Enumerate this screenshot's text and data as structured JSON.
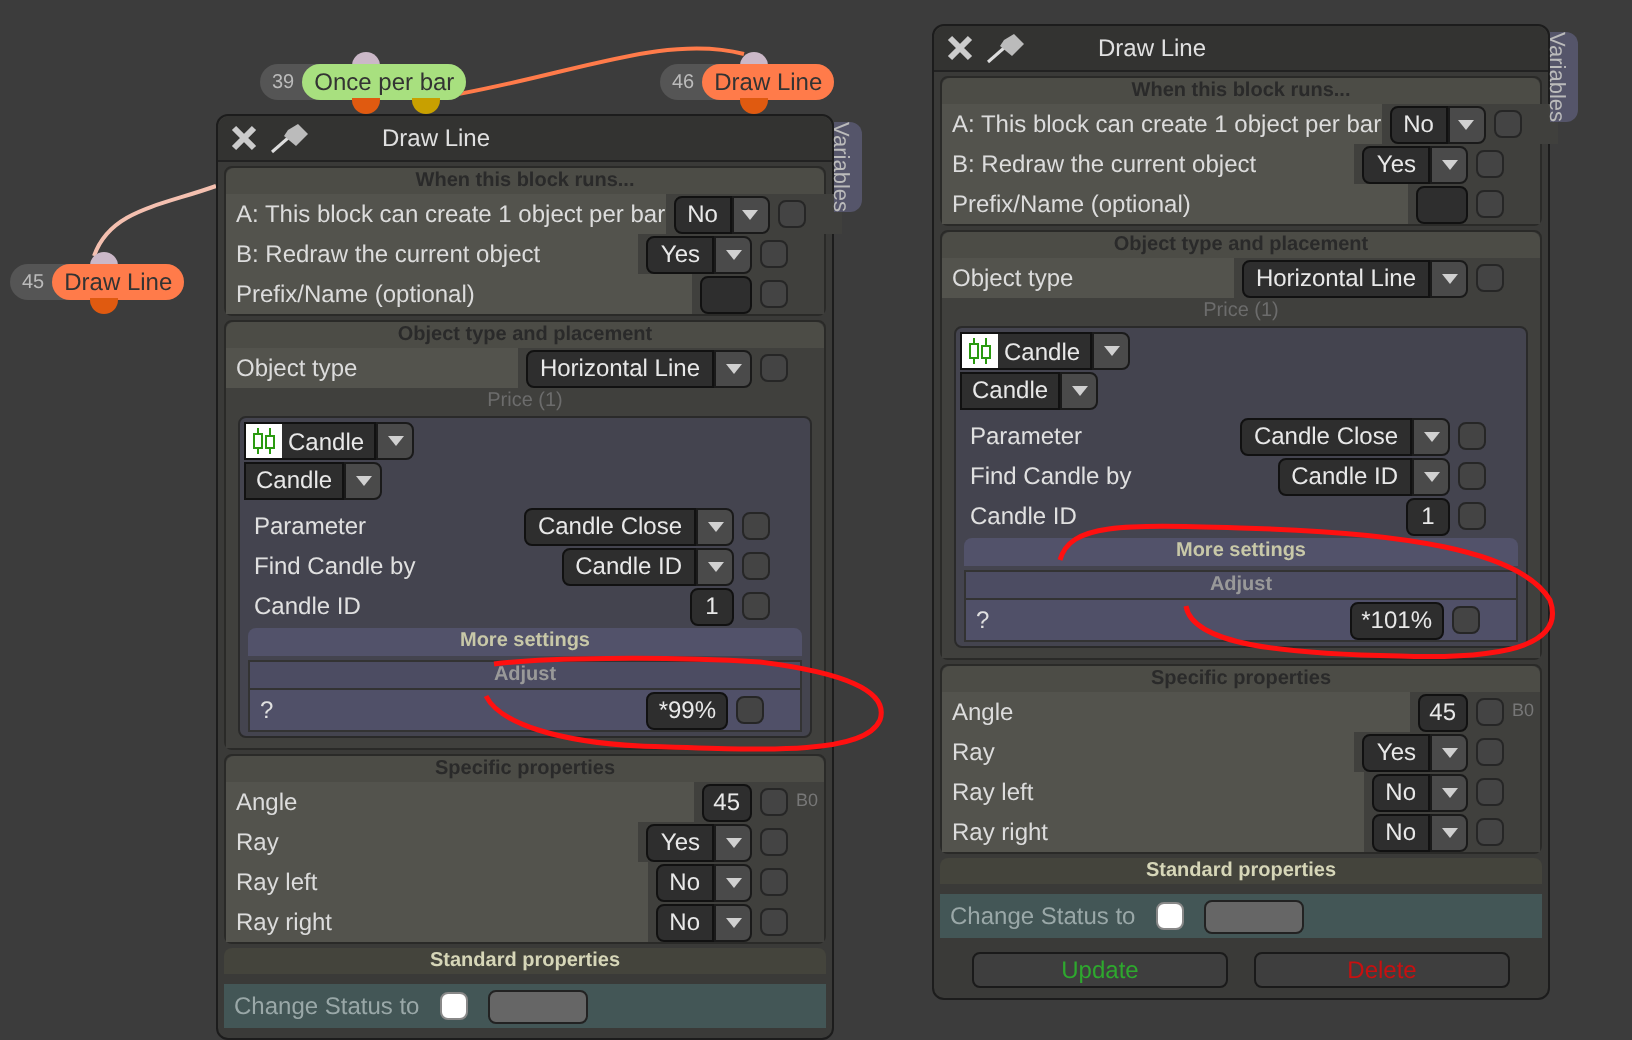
{
  "canvas_nodes": [
    {
      "number": "39",
      "label": "Once per bar",
      "color": "#a8e07f"
    },
    {
      "number": "46",
      "label": "Draw Line",
      "color": "#ff7b4a"
    },
    {
      "number": "45",
      "label": "Draw Line",
      "color": "#ff7b4a"
    }
  ],
  "panels": [
    {
      "title": "Draw Line",
      "side_tab": "Variables",
      "sections": [
        {
          "kind": "rows",
          "heading": "When this block runs...",
          "rows": [
            {
              "kind": "dropdown",
              "label": "A: This block can create 1 object per bar",
              "value": "No",
              "checked": false
            },
            {
              "kind": "dropdown",
              "label": "B: Redraw the current object",
              "value": "Yes",
              "checked": false
            },
            {
              "kind": "input",
              "label": "Prefix/Name (optional)",
              "checked": false
            }
          ]
        },
        {
          "kind": "rows",
          "heading": "Object type and placement",
          "rows": [
            {
              "kind": "dropdown",
              "label": "Object type",
              "value": "Horizontal Line",
              "checked": false
            }
          ],
          "group": {
            "caption": "Price (1)",
            "source": "Candle",
            "mode": "Candle",
            "rows": [
              {
                "kind": "dropdown",
                "label": "Parameter",
                "value": "Candle Close",
                "checked": false
              },
              {
                "kind": "dropdown",
                "label": "Find Candle by",
                "value": "Candle ID",
                "checked": false
              },
              {
                "kind": "input",
                "label": "Candle ID",
                "value": "1",
                "checked": false
              }
            ],
            "more": "More settings",
            "sub_heading": "Adjust",
            "sub_rows": [
              {
                "kind": "input",
                "label": "?",
                "value": "*99%",
                "checked": false
              }
            ]
          }
        },
        {
          "kind": "rows",
          "heading": "Specific properties",
          "rows": [
            {
              "kind": "input",
              "label": "Angle",
              "value": "45",
              "checked": false,
              "note": "B0"
            },
            {
              "kind": "dropdown",
              "label": "Ray",
              "value": "Yes",
              "checked": false
            },
            {
              "kind": "dropdown",
              "label": "Ray left",
              "value": "No",
              "checked": false
            },
            {
              "kind": "dropdown",
              "label": "Ray right",
              "value": "No",
              "checked": false
            }
          ]
        },
        {
          "kind": "status",
          "heading": "Standard properties",
          "label": "Change Status to",
          "checked": false
        }
      ]
    },
    {
      "title": "Draw Line",
      "side_tab": "Variables",
      "sections": [
        {
          "kind": "rows",
          "heading": "When this block runs...",
          "rows": [
            {
              "kind": "dropdown",
              "label": "A: This block can create 1 object per bar",
              "value": "No",
              "checked": false
            },
            {
              "kind": "dropdown",
              "label": "B: Redraw the current object",
              "value": "Yes",
              "checked": false
            },
            {
              "kind": "input",
              "label": "Prefix/Name (optional)",
              "checked": false
            }
          ]
        },
        {
          "kind": "rows",
          "heading": "Object type and placement",
          "rows": [
            {
              "kind": "dropdown",
              "label": "Object type",
              "value": "Horizontal Line",
              "checked": false
            }
          ],
          "group": {
            "caption": "Price (1)",
            "source": "Candle",
            "mode": "Candle",
            "rows": [
              {
                "kind": "dropdown",
                "label": "Parameter",
                "value": "Candle Close",
                "checked": false
              },
              {
                "kind": "dropdown",
                "label": "Find Candle by",
                "value": "Candle ID",
                "checked": false
              },
              {
                "kind": "input",
                "label": "Candle ID",
                "value": "1",
                "checked": false
              }
            ],
            "more": "More settings",
            "sub_heading": "Adjust",
            "sub_rows": [
              {
                "kind": "input",
                "label": "?",
                "value": "*101%",
                "checked": false
              }
            ]
          }
        },
        {
          "kind": "rows",
          "heading": "Specific properties",
          "rows": [
            {
              "kind": "input",
              "label": "Angle",
              "value": "45",
              "checked": false,
              "note": "B0"
            },
            {
              "kind": "dropdown",
              "label": "Ray",
              "value": "Yes",
              "checked": false
            },
            {
              "kind": "dropdown",
              "label": "Ray left",
              "value": "No",
              "checked": false
            },
            {
              "kind": "dropdown",
              "label": "Ray right",
              "value": "No",
              "checked": false
            }
          ]
        },
        {
          "kind": "status",
          "heading": "Standard properties",
          "label": "Change Status to",
          "checked": false
        }
      ],
      "buttons": [
        {
          "label": "Update",
          "kind": "update"
        },
        {
          "label": "Delete",
          "kind": "delete"
        }
      ]
    }
  ]
}
